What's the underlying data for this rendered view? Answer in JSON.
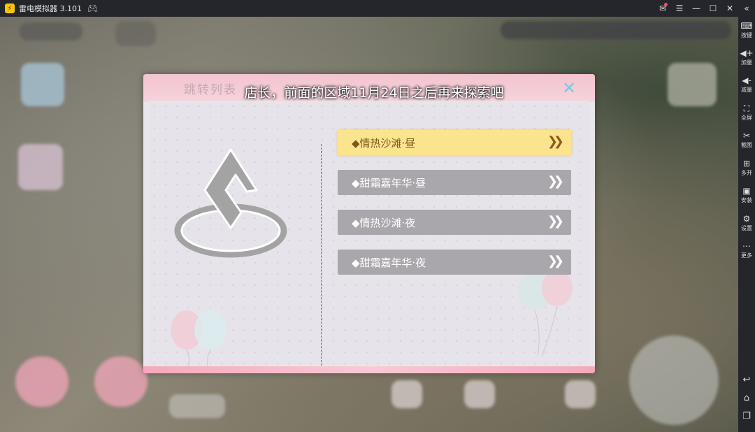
{
  "window": {
    "title": "雷电模拟器 3.101"
  },
  "sidebar": {
    "items": [
      {
        "label": "按键",
        "icon": "keyboard-icon"
      },
      {
        "label": "加量",
        "icon": "volume-up-icon"
      },
      {
        "label": "减量",
        "icon": "volume-down-icon"
      },
      {
        "label": "全屏",
        "icon": "fullscreen-icon"
      },
      {
        "label": "截图",
        "icon": "scissors-icon"
      },
      {
        "label": "多开",
        "icon": "multi-instance-icon"
      },
      {
        "label": "安装",
        "icon": "apk-install-icon"
      },
      {
        "label": "设置",
        "icon": "gear-icon"
      },
      {
        "label": "更多",
        "icon": "more-icon"
      }
    ]
  },
  "dialog": {
    "ghost_title": "跳转列表",
    "notice": "店长，前面的区域11月24日之后再来探索吧",
    "options": [
      {
        "label": "◆情热沙滩·昼",
        "state": "selected"
      },
      {
        "label": "◆甜霜嘉年华·昼",
        "state": "normal"
      },
      {
        "label": "◆情热沙滩·夜",
        "state": "normal"
      },
      {
        "label": "◆甜霜嘉年华·夜",
        "state": "normal"
      }
    ]
  },
  "colors": {
    "selected_button": "#fbe48e",
    "normal_button": "#a9a7ac",
    "header_pink": "#f3c4cf",
    "titlebar": "#24262b"
  }
}
